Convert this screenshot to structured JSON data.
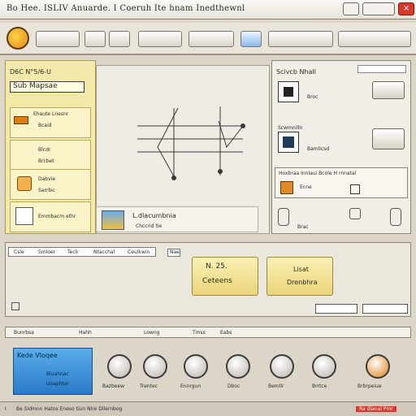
{
  "window": {
    "title": "Bo Hee. ISLIV Anuarde. I Coeruh Ite hnam Inedthewnl"
  },
  "toolbar": {
    "items": [
      "",
      "",
      "",
      "",
      "",
      "",
      ""
    ]
  },
  "left_panel": {
    "header": "D6C N°5/6-U",
    "section": "Sub Mapsae",
    "cards": [
      {
        "title": "Ehaute Lnesnr",
        "sub": "Bcaid"
      },
      {
        "title": "Blcdr",
        "sub": "Brcbet"
      },
      {
        "title": "Dabvie",
        "sub": "Sarrbic"
      },
      {
        "title": "Emmbacm ethr",
        "sub": ""
      }
    ]
  },
  "canvas": {
    "preview_label": "L.dlacumbnia",
    "preview_sub": "Chccrid tie"
  },
  "right_panel": {
    "header": "Scivcb Nhall",
    "row1": {
      "title": "Broc",
      "sub": ""
    },
    "row2": {
      "title": "Scwmnilln",
      "sub": "Bamlicsd"
    },
    "row3": {
      "title": "Hoxbraa Innlaui Bcole H rnnatal",
      "sub": "Ecne"
    },
    "row4": {
      "title": "Brac",
      "sub": ""
    }
  },
  "mid_bar": {
    "tabs": [
      "Csle",
      "Smloer",
      "Teclr",
      "Ntacchal",
      "Ceulkwin"
    ],
    "field": "Nae"
  },
  "buttons": {
    "b1": {
      "line1": "N. 25.",
      "line2": "Ceteens"
    },
    "b2": {
      "line1": "Lisat",
      "line2": "Drenbhra"
    }
  },
  "bottom_nav": {
    "items": [
      "Bunrbsa",
      "Hahh",
      "Lowng",
      "Tmss",
      "Eabs"
    ]
  },
  "blue_card": {
    "title": "Kede Vloqee",
    "line1": "Bluahnac",
    "line2": "Uoaphtar"
  },
  "knobs": [
    {
      "label": "Bazbeew"
    },
    {
      "label": "Trentec"
    },
    {
      "label": "Ennrgun"
    },
    {
      "label": "Dboc"
    },
    {
      "label": "Bemllr"
    },
    {
      "label": "Brrtce"
    },
    {
      "label": "Brbrpeiue"
    }
  ],
  "footer": {
    "left": "I",
    "status": "Be Sidmnn Hatos Eneso tiun Nlre Dllernbog",
    "right": "Ra dlanal Pmr"
  },
  "colors": {
    "accent_yellow": "#f3e9a8",
    "accent_blue": "#3b8fd8",
    "accent_orange": "#e07d10",
    "close_red": "#d83a2a"
  }
}
